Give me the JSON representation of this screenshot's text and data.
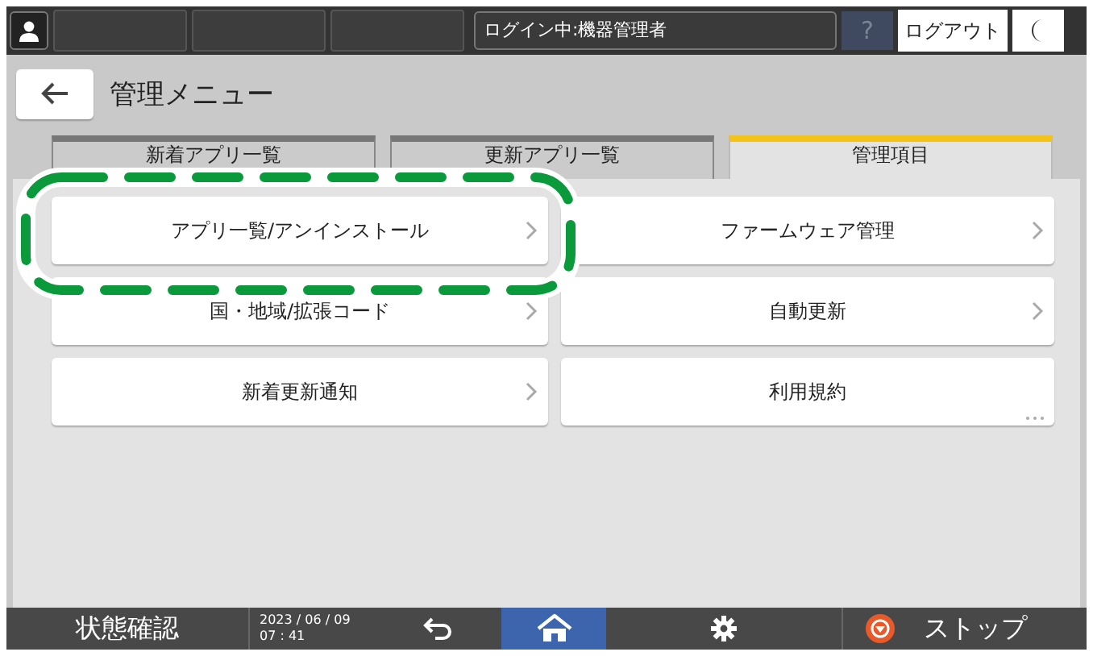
{
  "top_bar": {
    "login_status": "ログイン中:機器管理者",
    "help": {
      "label": "?",
      "disabled": true
    },
    "logout": "ログアウト"
  },
  "header": {
    "title": "管理メニュー"
  },
  "tabs": [
    {
      "label": "新着アプリ一覧",
      "selected": false
    },
    {
      "label": "更新アプリ一覧",
      "selected": false
    },
    {
      "label": "管理項目",
      "selected": true
    }
  ],
  "menu_items": [
    {
      "label": "アプリ一覧/アンインストール",
      "kind": "submenu"
    },
    {
      "label": "ファームウェア管理",
      "kind": "submenu"
    },
    {
      "label": "国・地域/拡張コード",
      "kind": "submenu"
    },
    {
      "label": "自動更新",
      "kind": "submenu"
    },
    {
      "label": "新着更新通知",
      "kind": "submenu"
    },
    {
      "label": "利用規約",
      "kind": "dialog"
    }
  ],
  "bottom_bar": {
    "status": "状態確認",
    "date": "2023 / 06 / 09",
    "time": "07 : 41",
    "nav": [
      {
        "kind": "back",
        "selected": false
      },
      {
        "kind": "home",
        "selected": true
      },
      {
        "kind": "settings",
        "selected": false
      }
    ],
    "stop": "ストップ"
  }
}
